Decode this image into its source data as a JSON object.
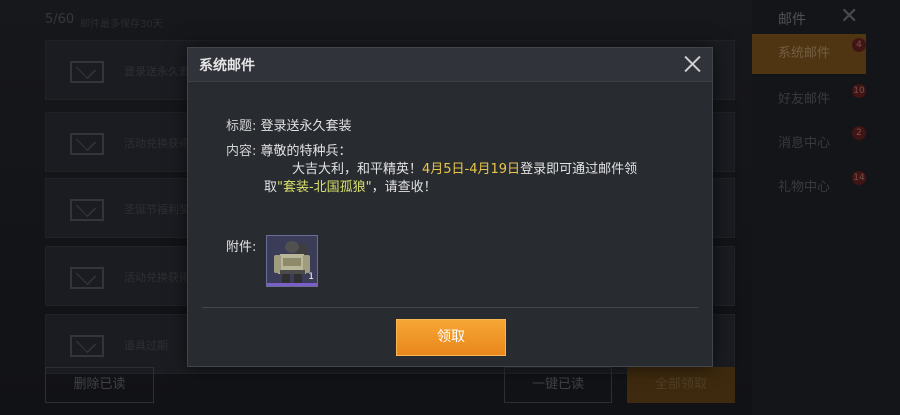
{
  "background": {
    "mail_count": "5/60",
    "mail_count_note": "邮件最多保存30天",
    "rows": [
      {
        "text": "登录送永久套装"
      },
      {
        "text": "活动兑换获得"
      },
      {
        "text": "圣诞节福利奖励"
      },
      {
        "text": "活动兑换获得"
      },
      {
        "text": "道具过期"
      }
    ],
    "right_panel": {
      "title": "邮件",
      "tabs": [
        {
          "label": "系统邮件",
          "badge": "4"
        },
        {
          "label": "好友邮件",
          "badge": "10"
        },
        {
          "label": "消息中心",
          "badge": "2"
        },
        {
          "label": "礼物中心",
          "badge": "14"
        }
      ]
    },
    "buttons": {
      "delete_read": "删除已读",
      "mark_all_read": "一键已读",
      "claim_all": "全部领取"
    }
  },
  "dialog": {
    "title": "系统邮件",
    "subject_label": "标题:",
    "subject_value": "登录送永久套装",
    "content_label": "内容:",
    "greeting": "尊敬的特种兵：",
    "line1_a": "大吉大利，和平精英！",
    "line1_dates": "4月5日-4月19日",
    "line1_b": "登录即可通过邮件领",
    "line2_a": "取",
    "line2_item": "\"套装-北国孤狼\"",
    "line2_b": "，请查收！",
    "attachment_label": "附件:",
    "attachment_qty": "1",
    "attachment_icon": "outfit-icon",
    "claim_button": "领取"
  },
  "colors": {
    "accent_orange": "#f0962a",
    "highlight_yellow": "#e8c64a",
    "highlight_item": "#d8e06a"
  }
}
